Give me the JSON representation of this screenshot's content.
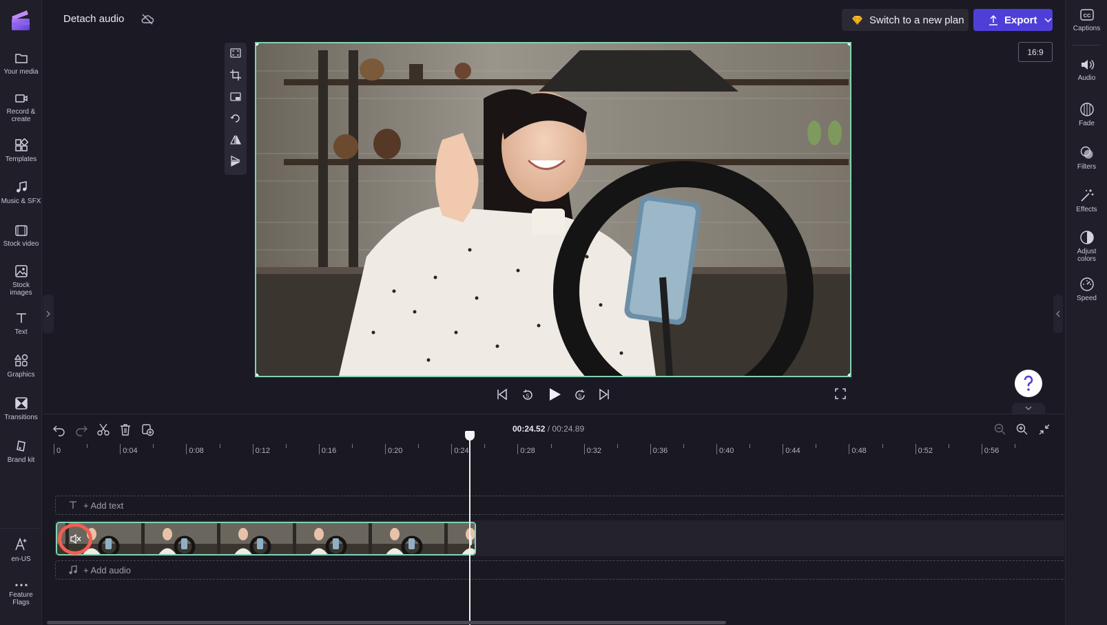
{
  "header": {
    "project_title": "Detach audio",
    "switch_plan_label": "Switch to a new plan",
    "export_label": "Export"
  },
  "left_rail": {
    "items": [
      {
        "label": "Your media",
        "icon": "folder-icon"
      },
      {
        "label": "Record &\ncreate",
        "icon": "camera-icon"
      },
      {
        "label": "Templates",
        "icon": "templates-icon"
      },
      {
        "label": "Music & SFX",
        "icon": "music-note-icon"
      },
      {
        "label": "Stock video",
        "icon": "film-icon"
      },
      {
        "label": "Stock\nimages",
        "icon": "image-icon"
      },
      {
        "label": "Text",
        "icon": "text-icon"
      },
      {
        "label": "Graphics",
        "icon": "shapes-icon"
      },
      {
        "label": "Transitions",
        "icon": "transitions-icon"
      },
      {
        "label": "Brand kit",
        "icon": "brand-kit-icon"
      }
    ],
    "bottom_items": [
      {
        "label": "en-US",
        "icon": "language-icon"
      },
      {
        "label": "Feature\nFlags",
        "icon": "more-dots-icon"
      }
    ]
  },
  "right_rail": {
    "items": [
      {
        "label": "Captions",
        "icon": "captions-icon"
      },
      {
        "label": "Audio",
        "icon": "speaker-icon"
      },
      {
        "label": "Fade",
        "icon": "fade-icon"
      },
      {
        "label": "Filters",
        "icon": "filters-icon"
      },
      {
        "label": "Effects",
        "icon": "effects-wand-icon"
      },
      {
        "label": "Adjust\ncolors",
        "icon": "adjust-colors-icon"
      },
      {
        "label": "Speed",
        "icon": "speedometer-icon"
      }
    ]
  },
  "preview": {
    "aspect_ratio": "16:9"
  },
  "timeline": {
    "current_time": "00:24.52",
    "separator": "/",
    "total_time": "00:24.89",
    "ruler_labels": [
      "0",
      "0:04",
      "0:08",
      "0:12",
      "0:16",
      "0:20",
      "0:24",
      "0:28",
      "0:32",
      "0:36",
      "0:40",
      "0:44",
      "0:48",
      "0:52",
      "0:56"
    ],
    "add_text_label": "+ Add text",
    "add_audio_label": "+ Add audio"
  },
  "colors": {
    "accent": "#4f3fd9",
    "clip_border": "#7fd4b4",
    "highlight": "#f25f52"
  }
}
